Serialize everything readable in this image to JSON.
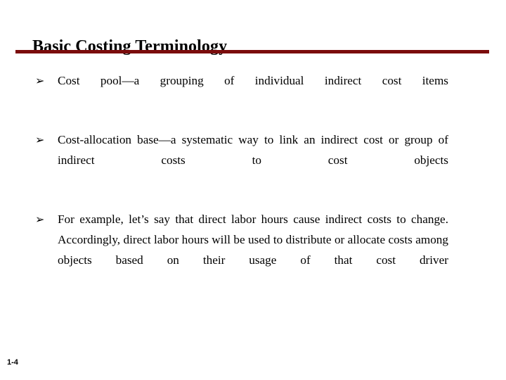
{
  "slide": {
    "title": "Basic Costing Terminology",
    "slide_number": "1-4",
    "accent_color": "#7b0c0c",
    "background_color": "#ffffff",
    "text_color": "#000000",
    "bullet_glyph": "➢",
    "bullet_icon_name": "arrowhead-bullet-icon",
    "bullets": [
      {
        "marker": "➢",
        "text": "Cost pool—a grouping of individual indirect cost items"
      },
      {
        "marker": "➢",
        "text": "Cost-allocation base—a systematic way to link an indirect cost or group of indirect costs to cost objects"
      },
      {
        "marker": "➢",
        "text": "For example, let’s say that direct labor hours cause indirect costs to change.  Accordingly, direct labor hours will be used to distribute or allocate costs among objects based on their usage of that cost driver"
      }
    ]
  }
}
